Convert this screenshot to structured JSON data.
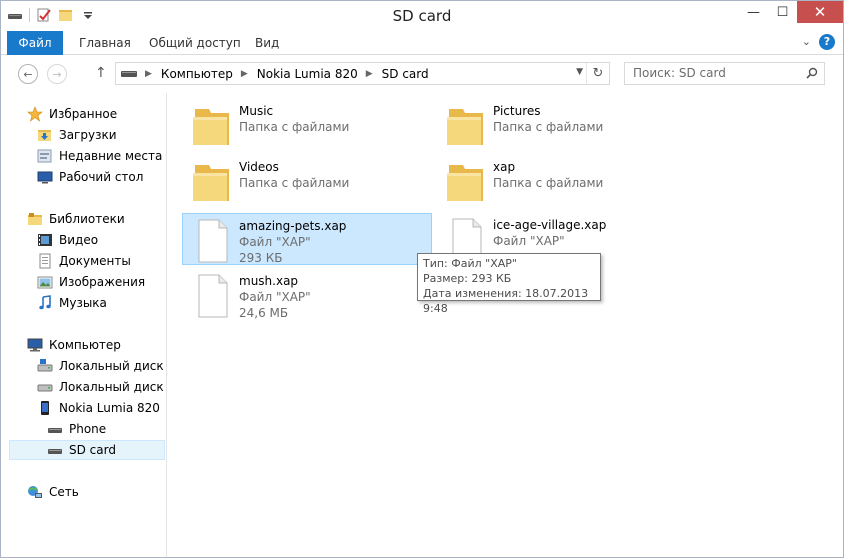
{
  "window": {
    "title": "SD card",
    "controls": {
      "minimize": "—",
      "maximize": "☐",
      "close": "✕"
    }
  },
  "ribbon": {
    "tabs": [
      {
        "label": "Файл"
      },
      {
        "label": "Главная"
      },
      {
        "label": "Общий доступ"
      },
      {
        "label": "Вид"
      }
    ],
    "help": "?"
  },
  "address": {
    "crumbs": [
      "Компьютер",
      "Nokia Lumia 820",
      "SD card"
    ]
  },
  "search": {
    "placeholder": "Поиск: SD card"
  },
  "nav_pane": {
    "favorites": {
      "label": "Избранное",
      "items": [
        {
          "label": "Загрузки",
          "icon": "downloads-folder-icon"
        },
        {
          "label": "Недавние места",
          "icon": "recent-places-icon"
        },
        {
          "label": "Рабочий стол",
          "icon": "desktop-icon"
        }
      ]
    },
    "libraries": {
      "label": "Библиотеки",
      "items": [
        {
          "label": "Видео",
          "icon": "video-library-icon"
        },
        {
          "label": "Документы",
          "icon": "documents-library-icon"
        },
        {
          "label": "Изображения",
          "icon": "pictures-library-icon"
        },
        {
          "label": "Музыка",
          "icon": "music-library-icon"
        }
      ]
    },
    "computer": {
      "label": "Компьютер",
      "items": [
        {
          "label": "Локальный диск (С",
          "icon": "local-disk-icon"
        },
        {
          "label": "Локальный диск (E:",
          "icon": "local-disk-icon"
        },
        {
          "label": "Nokia Lumia 820",
          "icon": "phone-device-icon"
        },
        {
          "label": "Phone",
          "icon": "drive-icon"
        },
        {
          "label": "SD card",
          "icon": "drive-icon",
          "selected": true
        }
      ]
    },
    "network": {
      "label": "Сеть"
    }
  },
  "content": {
    "items": [
      {
        "name": "Music",
        "sub": "Папка с файлами",
        "type": "folder"
      },
      {
        "name": "Pictures",
        "sub": "Папка с файлами",
        "type": "folder"
      },
      {
        "name": "Videos",
        "sub": "Папка с файлами",
        "type": "folder"
      },
      {
        "name": "xap",
        "sub": "Папка с файлами",
        "type": "folder"
      },
      {
        "name": "amazing-pets.xap",
        "sub": "Файл \"XAP\"",
        "size": "293 КБ",
        "type": "file",
        "selected": true
      },
      {
        "name": "ice-age-village.xap",
        "sub": "Файл \"XAP\"",
        "size": "",
        "type": "file"
      },
      {
        "name": "mush.xap",
        "sub": "Файл \"XAP\"",
        "size": "24,6 МБ",
        "type": "file"
      }
    ]
  },
  "tooltip": {
    "type": "Тип: Файл \"XAP\"",
    "size": "Размер: 293 КБ",
    "modified": "Дата изменения: 18.07.2013 9:48"
  },
  "colors": {
    "accent": "#1979ca",
    "selection": "#cce8ff",
    "close": "#c7504f",
    "folder": "#f5d77c"
  }
}
